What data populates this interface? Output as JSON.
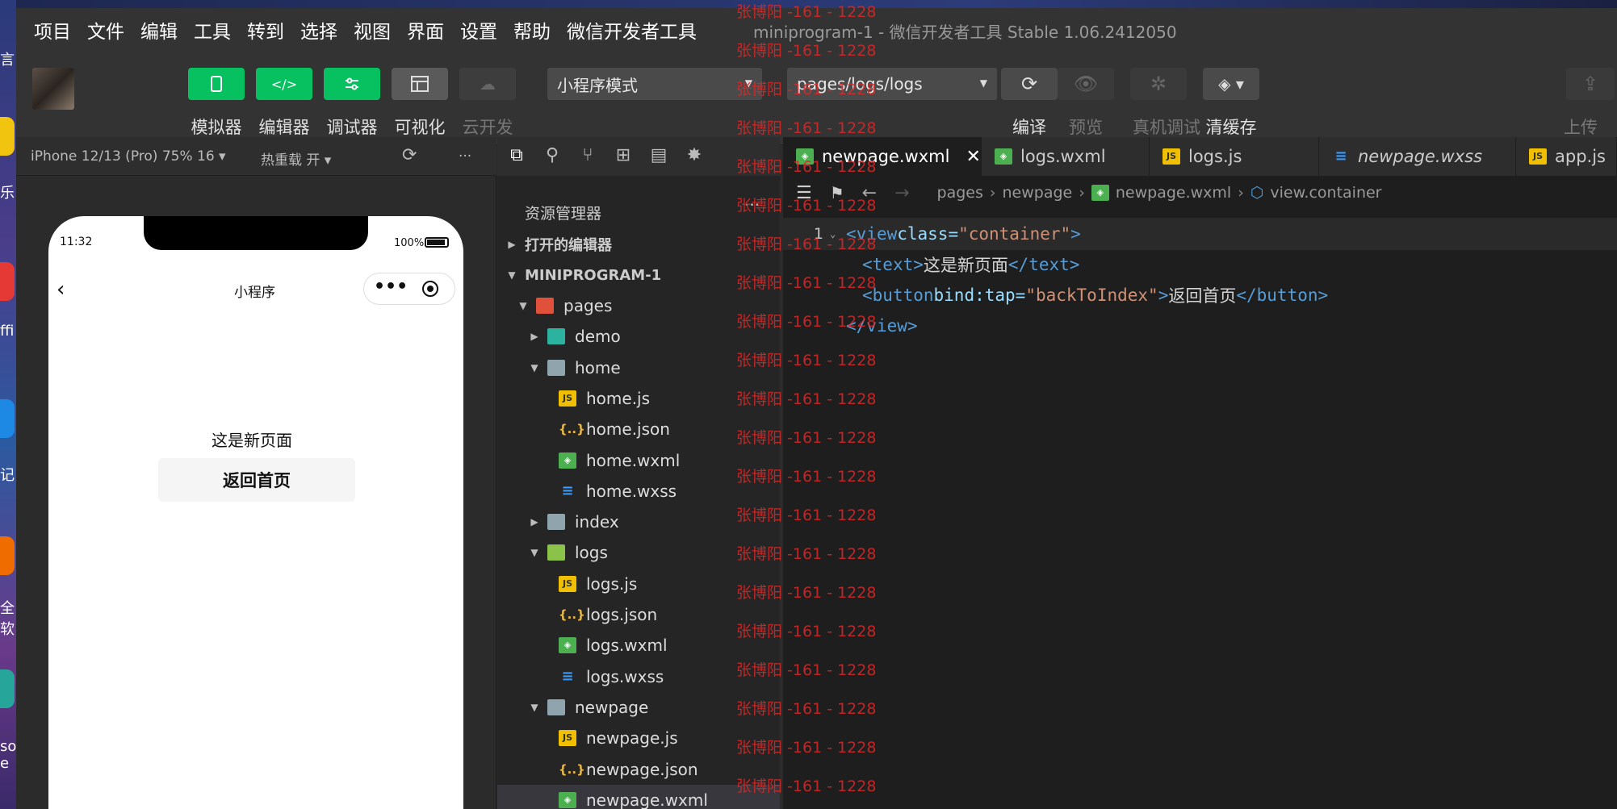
{
  "window_title": "miniprogram-1 - 微信开发者工具 Stable 1.06.2412050",
  "menu": [
    "项目",
    "文件",
    "编辑",
    "工具",
    "转到",
    "选择",
    "视图",
    "界面",
    "设置",
    "帮助",
    "微信开发者工具"
  ],
  "toolbar": {
    "simulator": "模拟器",
    "editor": "编辑器",
    "debugger": "调试器",
    "visual": "可视化",
    "cloud": "云开发",
    "mode_select": "小程序模式",
    "page_select": "pages/logs/logs",
    "compile": "编译",
    "preview": "预览",
    "real_debug": "真机调试",
    "clear_cache": "清缓存",
    "upload": "上传"
  },
  "simulator": {
    "device": "iPhone 12/13 (Pro) 75% 16 ▾",
    "hot_reload": "热重载 开 ▾",
    "more": "···",
    "status_time": "11:32",
    "battery": "100%",
    "nav_title": "小程序",
    "page_text": "这是新页面",
    "back_button": "返回首页"
  },
  "explorer": {
    "title": "资源管理器",
    "more": "···",
    "open_editors": "打开的编辑器",
    "project": "MINIPROGRAM-1",
    "tree": [
      {
        "label": "pages",
        "depth": 1,
        "type": "folder-red",
        "open": true
      },
      {
        "label": "demo",
        "depth": 2,
        "type": "folder-teal",
        "open": false
      },
      {
        "label": "home",
        "depth": 2,
        "type": "folder-gray",
        "open": true
      },
      {
        "label": "home.js",
        "depth": 3,
        "type": "js"
      },
      {
        "label": "home.json",
        "depth": 3,
        "type": "json"
      },
      {
        "label": "home.wxml",
        "depth": 3,
        "type": "wxml"
      },
      {
        "label": "home.wxss",
        "depth": 3,
        "type": "wxss"
      },
      {
        "label": "index",
        "depth": 2,
        "type": "folder-gray",
        "open": false
      },
      {
        "label": "logs",
        "depth": 2,
        "type": "folder-green",
        "open": true
      },
      {
        "label": "logs.js",
        "depth": 3,
        "type": "js"
      },
      {
        "label": "logs.json",
        "depth": 3,
        "type": "json"
      },
      {
        "label": "logs.wxml",
        "depth": 3,
        "type": "wxml"
      },
      {
        "label": "logs.wxss",
        "depth": 3,
        "type": "wxss"
      },
      {
        "label": "newpage",
        "depth": 2,
        "type": "folder-gray",
        "open": true
      },
      {
        "label": "newpage.js",
        "depth": 3,
        "type": "js"
      },
      {
        "label": "newpage.json",
        "depth": 3,
        "type": "json"
      },
      {
        "label": "newpage.wxml",
        "depth": 3,
        "type": "wxml",
        "selected": true
      }
    ]
  },
  "tabs": [
    {
      "label": "newpage.wxml",
      "type": "wxml",
      "active": true
    },
    {
      "label": "logs.wxml",
      "type": "wxml"
    },
    {
      "label": "logs.js",
      "type": "js"
    },
    {
      "label": "newpage.wxss",
      "type": "wxss"
    },
    {
      "label": "app.js",
      "type": "js"
    }
  ],
  "breadcrumb": [
    "pages",
    "newpage",
    "newpage.wxml",
    "view.container"
  ],
  "code": {
    "line_number": "1",
    "lines": [
      [
        "<",
        "view",
        " class=",
        "\"container\"",
        ">"
      ],
      [
        "<",
        "text",
        ">",
        "这是新页面",
        "</",
        "text",
        ">"
      ],
      [
        "<",
        "button",
        " bind:tap=",
        "\"backToIndex\"",
        ">",
        "返回首页",
        "</",
        "button",
        ">"
      ],
      [
        "</",
        "view",
        ">"
      ]
    ]
  },
  "watermark": "张博阳 -161 - 1228",
  "colors": {
    "accent_green": "#07c160",
    "watermark": "#dc2828"
  }
}
